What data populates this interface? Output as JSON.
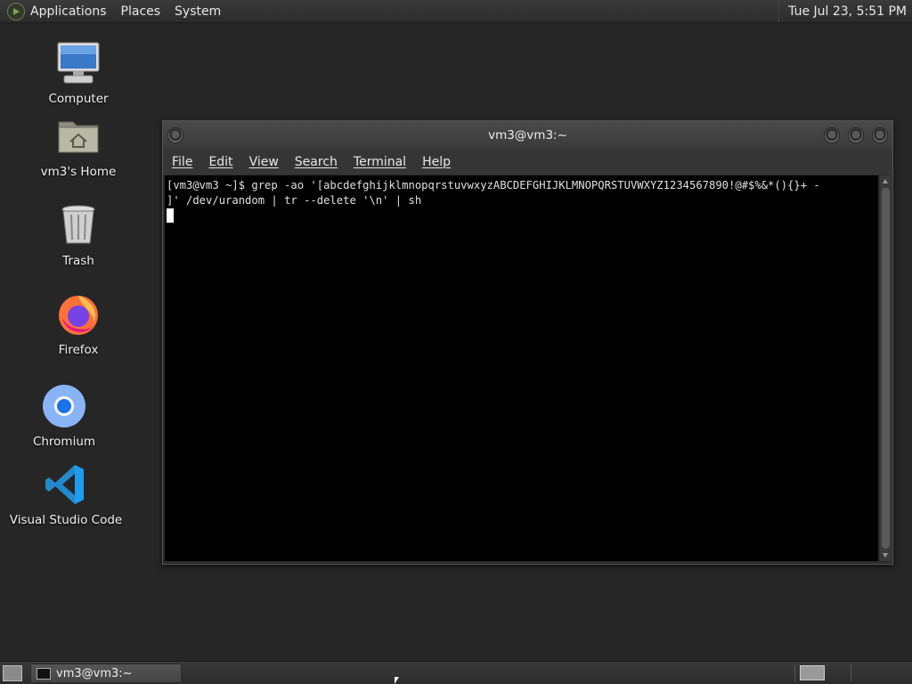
{
  "top_panel": {
    "menus": [
      "Applications",
      "Places",
      "System"
    ],
    "clock": "Tue Jul 23,  5:51 PM"
  },
  "desktop_icons": [
    {
      "label": "Computer",
      "icon": "computer-icon"
    },
    {
      "label": "vm3's Home",
      "icon": "home-folder-icon"
    },
    {
      "label": "Trash",
      "icon": "trash-icon"
    },
    {
      "label": "Firefox",
      "icon": "firefox-icon"
    },
    {
      "label": "Chromium",
      "icon": "chromium-icon"
    },
    {
      "label": "Visual Studio Code",
      "icon": "vscode-icon"
    }
  ],
  "terminal": {
    "title": "vm3@vm3:~",
    "menu": [
      "File",
      "Edit",
      "View",
      "Search",
      "Terminal",
      "Help"
    ],
    "lines": [
      "[vm3@vm3 ~]$ grep -ao '[abcdefghijklmnopqrstuvwxyzABCDEFGHIJKLMNOPQRSTUVWXYZ1234567890!@#$%&*(){}+ -",
      "]' /dev/urandom | tr --delete '\\n' | sh"
    ]
  },
  "taskbar": {
    "tasks": [
      {
        "label": "vm3@vm3:~"
      }
    ]
  }
}
